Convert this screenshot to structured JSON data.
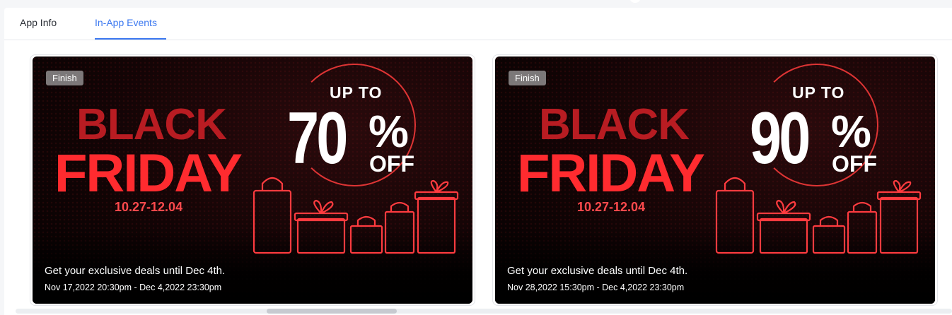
{
  "tabs": [
    {
      "label": "App Info",
      "active": false
    },
    {
      "label": "In-App Events",
      "active": true
    }
  ],
  "colors": {
    "accent": "#3b78f0",
    "banner_red": "#ff2b2f"
  },
  "events": [
    {
      "status": "Finish",
      "banner": {
        "line1": "BLACK",
        "line2": "FRIDAY",
        "dates": "10.27-12.04",
        "up_to": "UP TO",
        "discount": "70",
        "percent": "%",
        "off": "OFF"
      },
      "description": "Get your exclusive deals until Dec 4th.",
      "time_range": "Nov 17,2022 20:30pm - Dec 4,2022 23:30pm"
    },
    {
      "status": "Finish",
      "banner": {
        "line1": "BLACK",
        "line2": "FRIDAY",
        "dates": "10.27-12.04",
        "up_to": "UP TO",
        "discount": "90",
        "percent": "%",
        "off": "OFF"
      },
      "description": "Get your exclusive deals until Dec 4th.",
      "time_range": "Nov 28,2022 15:30pm - Dec 4,2022 23:30pm"
    }
  ]
}
